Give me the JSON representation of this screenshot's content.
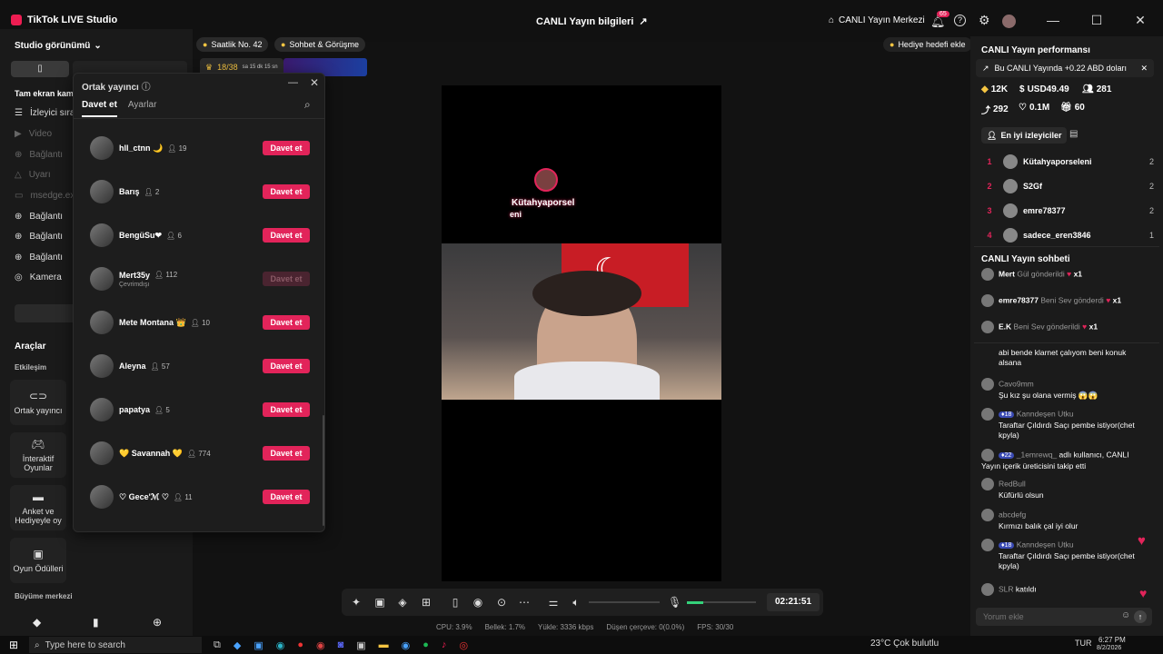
{
  "app": {
    "title": "TikTok LIVE Studio",
    "center_title": "CANLI Yayın bilgileri",
    "live_center": "CANLI Yayın Merkezi",
    "notif_count": "65"
  },
  "left": {
    "studio_view": "Studio görünümü",
    "fullscreen": "Tam ekran kam",
    "items": [
      {
        "label": "İzleyici sıral",
        "dim": false
      },
      {
        "label": "Video",
        "dim": true
      },
      {
        "label": "Bağlantı",
        "dim": true
      },
      {
        "label": "Uyarı",
        "dim": true
      },
      {
        "label": "msedge.exe",
        "dim": true
      },
      {
        "label": "Bağlantı",
        "dim": false
      },
      {
        "label": "Bağlantı",
        "dim": false
      },
      {
        "label": "Bağlantı",
        "dim": false
      },
      {
        "label": "Kamera",
        "dim": false
      }
    ],
    "tools_title": "Araçlar",
    "interaction": "Etkileşim",
    "tools": [
      "Ortak yayıncı",
      "İnteraktif Oyunlar",
      "Anket ve Hediyeyle oy",
      "Oyun Ödülleri"
    ],
    "growth": "Büyüme merkezi"
  },
  "chips": {
    "hourly": "Saatlik No. 42",
    "chat": "Sohbet & Görüşme",
    "progress": "18/38",
    "progress_time": "sa 15 dk 15 sn",
    "gift_goal": "Hediye hedefi ekle"
  },
  "popup": {
    "title": "Ortak yayıncı",
    "tabs": [
      "Davet et",
      "Ayarlar"
    ],
    "invites": [
      {
        "name": "hll_ctnn 🌙",
        "count": "19",
        "button": "Davet et",
        "sub": "",
        "enabled": true
      },
      {
        "name": "Barış",
        "count": "2",
        "button": "Davet et",
        "sub": "",
        "enabled": true
      },
      {
        "name": "BengüSu❤",
        "count": "6",
        "button": "Davet et",
        "sub": "",
        "enabled": true
      },
      {
        "name": "Mert35y",
        "count": "112",
        "button": "Davet et",
        "sub": "Çevrimdışı",
        "enabled": false
      },
      {
        "name": "Mete Montana 👑",
        "count": "10",
        "button": "Davet et",
        "sub": "",
        "enabled": true
      },
      {
        "name": "Aleyna",
        "count": "57",
        "button": "Davet et",
        "sub": "",
        "enabled": true
      },
      {
        "name": "papatya",
        "count": "5",
        "button": "Davet et",
        "sub": "",
        "enabled": true
      },
      {
        "name": "💛 Savannah 💛",
        "count": "774",
        "button": "Davet et",
        "sub": "",
        "enabled": true
      },
      {
        "name": "♡ Gece'ℳ ♡",
        "count": "11",
        "button": "Davet et",
        "sub": "",
        "enabled": true
      }
    ]
  },
  "video": {
    "overlay_name": "Kütahyaporsel",
    "overlay_name2": "eni",
    "timer": "02:21:51"
  },
  "stats": {
    "cpu": "CPU: 3.9%",
    "mem": "Bellek: 1.7%",
    "upload": "Yükle: 3336 kbps",
    "dropped": "Düşen çerçeve: 0(0.0%)",
    "fps": "FPS: 30/30"
  },
  "right": {
    "perf_title": "CANLI Yayın performansı",
    "banner": "Bu CANLI Yayında +0.22 ABD doları",
    "metrics": {
      "diamonds": "12K",
      "usd": "USD49.49",
      "viewers": "281",
      "shares": "292",
      "likes": "0.1M",
      "gifts": "60"
    },
    "top_viewers_btn": "En iyi izleyiciler",
    "viewers": [
      {
        "rank": "1",
        "name": "Kütahyaporseleni",
        "score": "2"
      },
      {
        "rank": "2",
        "name": "S2Gf",
        "score": "2"
      },
      {
        "rank": "3",
        "name": "emre78377",
        "score": "2"
      },
      {
        "rank": "4",
        "name": "sadece_eren3846",
        "score": "1"
      }
    ],
    "chat_title": "CANLI Yayın sohbeti",
    "gifts": [
      {
        "user": "Mert",
        "text": "Gül gönderildi",
        "mult": "x1"
      },
      {
        "user": "emre78377",
        "text": "Beni Sev gönderdi",
        "mult": "x1"
      },
      {
        "user": "E.K",
        "text": "Beni Sev gönderildi",
        "mult": "x1"
      }
    ],
    "messages": [
      {
        "user": "",
        "level": "",
        "text": "abi bende klarnet çalıyom beni konuk alsana"
      },
      {
        "user": "Cavo9mm",
        "level": "",
        "text": "Şu kız şu olana vermiş 😱😱"
      },
      {
        "user": "Kanndeşen Utku",
        "level": "18",
        "text": "Taraftar Çıldırdı Saçı pembe istiyor(chet kpyla)"
      },
      {
        "user": "_1emrewq_",
        "level": "22",
        "text": "adlı kullanıcı, CANLI Yayın içerik üreticisini takip etti"
      },
      {
        "user": "RedBull",
        "level": "",
        "text": "Küfürlü olsun"
      },
      {
        "user": "abcdefg",
        "level": "",
        "text": "Kırmızı balık çal iyi olur"
      },
      {
        "user": "Kanndeşen Utku",
        "level": "18",
        "text": "Taraftar Çıldırdı Saçı pembe istiyor(chet kpyla)"
      },
      {
        "user": "SLR",
        "level": "",
        "text": "katıldı"
      }
    ],
    "comment_placeholder": "Yorum ekle"
  },
  "taskbar": {
    "search": "Type here to search",
    "weather": "23°C  Çok bulutlu",
    "lang": "TUR",
    "time": "6:27 PM",
    "date": "8/2/2026"
  }
}
